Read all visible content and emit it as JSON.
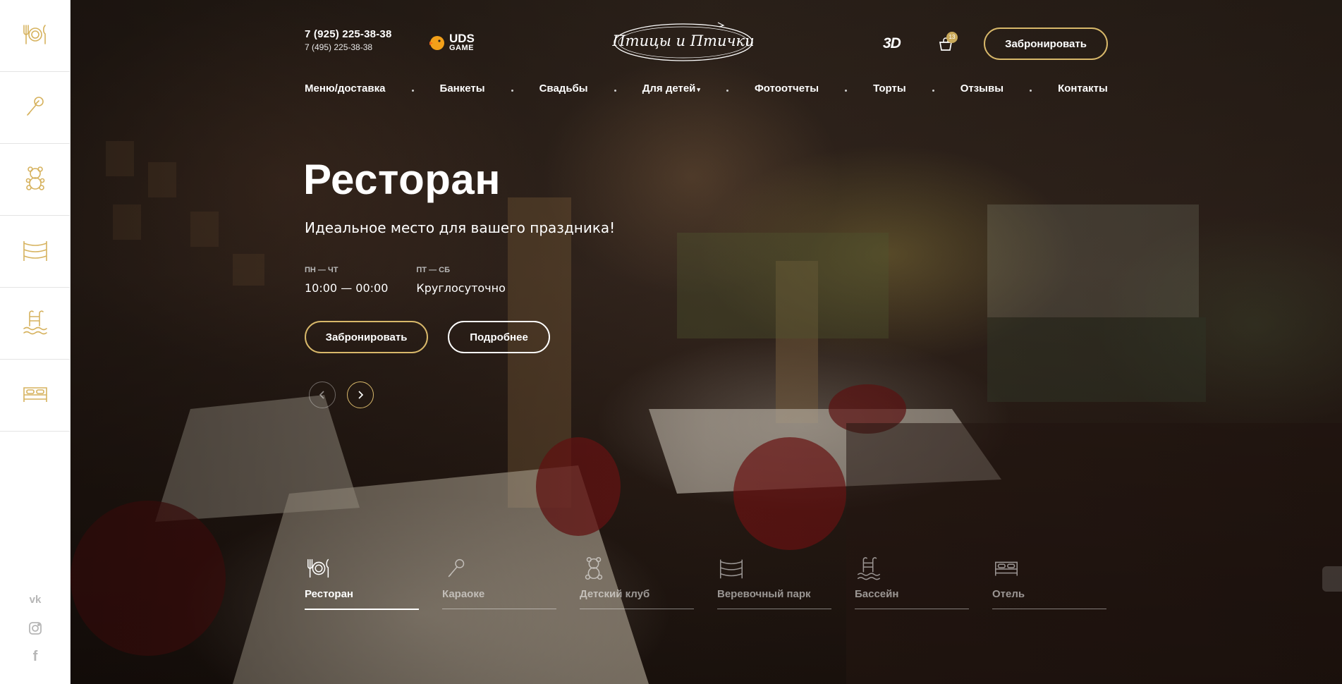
{
  "brand": {
    "logo_text": "Птицы и Птички",
    "uds_line1": "UDS",
    "uds_line2": "GAME"
  },
  "header": {
    "phone_main": "7 (925) 225-38-38",
    "phone_sub": "7 (495) 225-38-38",
    "btn_3d": "3D",
    "cart_count": "13",
    "book_button": "Забронировать"
  },
  "nav": {
    "menu": "Меню/доставка",
    "banquets": "Банкеты",
    "weddings": "Свадьбы",
    "kids": "Для детей",
    "photos": "Фотоотчеты",
    "cakes": "Торты",
    "reviews": "Отзывы",
    "contacts": "Контакты"
  },
  "hero": {
    "title": "Ресторан",
    "subtitle": "Идеальное место для вашего праздника!",
    "hours": [
      {
        "label": "ПН — ЧТ",
        "value": "10:00 — 00:00"
      },
      {
        "label": "ПТ — СБ",
        "value": "Круглосуточно"
      }
    ],
    "book_button": "Забронировать",
    "more_button": "Подробнее"
  },
  "tabs": [
    {
      "label": "Ресторан",
      "icon": "restaurant-icon",
      "active": true
    },
    {
      "label": "Караоке",
      "icon": "microphone-icon",
      "active": false
    },
    {
      "label": "Детский клуб",
      "icon": "teddy-bear-icon",
      "active": false
    },
    {
      "label": "Веревочный парк",
      "icon": "rope-park-icon",
      "active": false
    },
    {
      "label": "Бассейн",
      "icon": "pool-icon",
      "active": false
    },
    {
      "label": "Отель",
      "icon": "bed-icon",
      "active": false
    }
  ],
  "social": {
    "vk": "vk",
    "instagram": "instagram",
    "facebook": "f"
  },
  "colors": {
    "accent": "#d8b86a",
    "sidebar_icon": "#d6b25e"
  }
}
